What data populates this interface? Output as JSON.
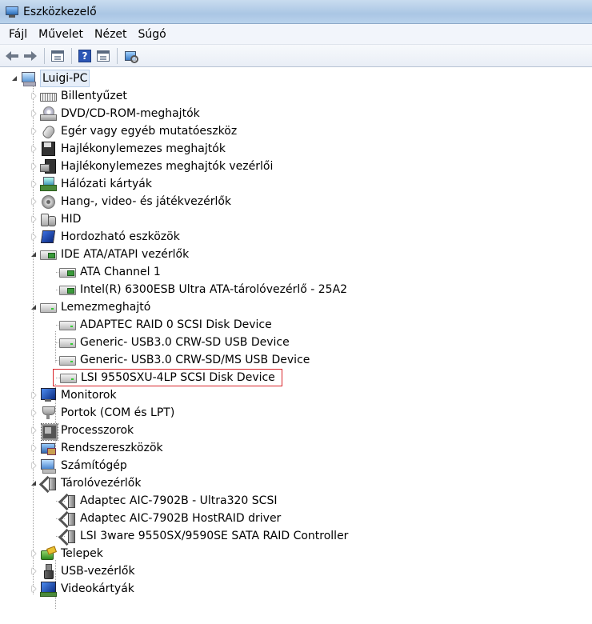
{
  "window": {
    "title": "Eszközkezelő"
  },
  "menu": {
    "file": "Fájl",
    "action": "Művelet",
    "view": "Nézet",
    "help": "Súgó"
  },
  "toolbar": {
    "help_glyph": "?"
  },
  "tree": {
    "root": "Luigi-PC",
    "categories": {
      "keyboard": "Billentyűzet",
      "dvd": "DVD/CD-ROM-meghajtók",
      "mouse": "Egér vagy egyéb mutatóeszköz",
      "floppy": "Hajlékonylemezes meghajtók",
      "floppy_ctrl": "Hajlékonylemezes meghajtók vezérlői",
      "network": "Hálózati kártyák",
      "sound": "Hang-, video- és játékvezérlők",
      "hid": "HID",
      "portable": "Hordozható eszközök",
      "ide": "IDE ATA/ATAPI vezérlők",
      "disk": "Lemezmeghajtó",
      "monitors": "Monitorok",
      "ports": "Portok (COM és LPT)",
      "processors": "Processzorok",
      "system": "Rendszereszközök",
      "computer": "Számítógép",
      "storage": "Tárolóvezérlők",
      "batteries": "Telepek",
      "usb": "USB-vezérlők",
      "video": "Videokártyák"
    },
    "ide_children": [
      "ATA Channel 1",
      "Intel(R) 6300ESB Ultra ATA-tárolóvezérlő - 25A2"
    ],
    "disk_children": [
      "ADAPTEC RAID 0 SCSI Disk Device",
      "Generic- USB3.0 CRW-SD USB Device",
      "Generic- USB3.0 CRW-SD/MS USB Device",
      "LSI 9550SXU-4LP SCSI Disk Device"
    ],
    "storage_children": [
      "Adaptec AIC-7902B - Ultra320 SCSI",
      "Adaptec AIC-7902B HostRAID driver",
      "LSI 3ware 9550SX/9590SE SATA RAID Controller"
    ]
  },
  "colors": {
    "selection_outline": "#d9242a"
  }
}
